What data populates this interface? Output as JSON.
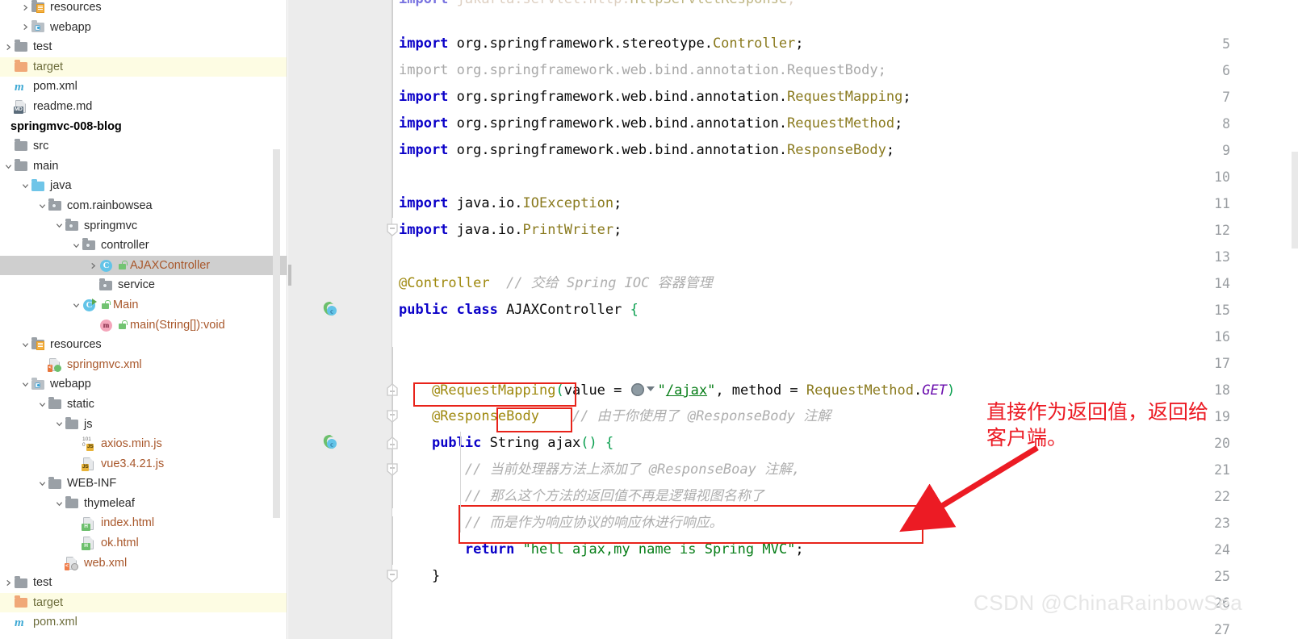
{
  "project_tree": {
    "items": [
      {
        "indent": 1,
        "arrow": "chevron-right",
        "icon": "folder-resources",
        "label": "resources",
        "style": "plain",
        "state": "collapsed"
      },
      {
        "indent": 1,
        "arrow": "chevron-right",
        "icon": "folder-webapp",
        "label": "webapp",
        "style": "plain",
        "state": "collapsed"
      },
      {
        "indent": 0,
        "arrow": "chevron-right",
        "icon": "folder-grey",
        "label": "test",
        "style": "plain",
        "state": "collapsed"
      },
      {
        "indent": 0,
        "arrow": "none",
        "icon": "folder-orange",
        "label": "target",
        "style": "olive",
        "state": "highlighted"
      },
      {
        "indent": 0,
        "arrow": "none",
        "icon": "maven-pom",
        "label": "pom.xml",
        "style": "plain",
        "state": "none"
      },
      {
        "indent": 0,
        "arrow": "none",
        "icon": "file-md",
        "label": "readme.md",
        "style": "plain",
        "state": "none"
      },
      {
        "indent": -1,
        "arrow": "none",
        "icon": "none",
        "label": "springmvc-008-blog",
        "style": "bold",
        "state": "none"
      },
      {
        "indent": 0,
        "arrow": "none",
        "icon": "folder-grey",
        "label": "src",
        "style": "plain",
        "state": "none"
      },
      {
        "indent": 0,
        "arrow": "chevron-down",
        "icon": "folder-grey",
        "label": "main",
        "style": "plain",
        "state": "expanded"
      },
      {
        "indent": 1,
        "arrow": "chevron-down",
        "icon": "folder-blue",
        "label": "java",
        "style": "plain",
        "state": "expanded"
      },
      {
        "indent": 2,
        "arrow": "chevron-down",
        "icon": "folder-package",
        "label": "com.rainbowsea",
        "style": "plain",
        "state": "expanded"
      },
      {
        "indent": 3,
        "arrow": "chevron-down",
        "icon": "folder-package",
        "label": "springmvc",
        "style": "plain",
        "state": "expanded"
      },
      {
        "indent": 4,
        "arrow": "chevron-down",
        "icon": "folder-package",
        "label": "controller",
        "style": "plain",
        "state": "expanded"
      },
      {
        "indent": 5,
        "arrow": "chevron-right",
        "icon": "java-class",
        "label": "AJAXController",
        "style": "orange",
        "state": "selected",
        "lock": true
      },
      {
        "indent": 5,
        "arrow": "none",
        "icon": "folder-package",
        "label": "service",
        "style": "plain",
        "state": "none"
      },
      {
        "indent": 4,
        "arrow": "chevron-down",
        "icon": "java-class-runnable",
        "label": "Main",
        "style": "orange",
        "state": "expanded",
        "lock": true
      },
      {
        "indent": 5,
        "arrow": "none",
        "icon": "java-method",
        "label": "main(String[]):void",
        "style": "orange",
        "state": "none",
        "lock": true
      },
      {
        "indent": 1,
        "arrow": "chevron-down",
        "icon": "folder-resources",
        "label": "resources",
        "style": "plain",
        "state": "expanded"
      },
      {
        "indent": 2,
        "arrow": "none",
        "icon": "file-spring-xml",
        "label": "springmvc.xml",
        "style": "orange",
        "state": "none"
      },
      {
        "indent": 1,
        "arrow": "chevron-down",
        "icon": "folder-webapp",
        "label": "webapp",
        "style": "plain",
        "state": "expanded"
      },
      {
        "indent": 2,
        "arrow": "chevron-down",
        "icon": "folder-grey",
        "label": "static",
        "style": "plain",
        "state": "expanded"
      },
      {
        "indent": 3,
        "arrow": "chevron-down",
        "icon": "folder-grey",
        "label": "js",
        "style": "plain",
        "state": "expanded"
      },
      {
        "indent": 4,
        "arrow": "none",
        "icon": "file-js-minified",
        "label": "axios.min.js",
        "style": "orange",
        "state": "none"
      },
      {
        "indent": 4,
        "arrow": "none",
        "icon": "file-js",
        "label": "vue3.4.21.js",
        "style": "orange",
        "state": "none"
      },
      {
        "indent": 2,
        "arrow": "chevron-down",
        "icon": "folder-grey",
        "label": "WEB-INF",
        "style": "plain",
        "state": "expanded"
      },
      {
        "indent": 3,
        "arrow": "chevron-down",
        "icon": "folder-grey",
        "label": "thymeleaf",
        "style": "plain",
        "state": "expanded"
      },
      {
        "indent": 4,
        "arrow": "none",
        "icon": "file-html",
        "label": "index.html",
        "style": "orange",
        "state": "none"
      },
      {
        "indent": 4,
        "arrow": "none",
        "icon": "file-html",
        "label": "ok.html",
        "style": "orange",
        "state": "none"
      },
      {
        "indent": 3,
        "arrow": "none",
        "icon": "file-web-xml",
        "label": "web.xml",
        "style": "orange",
        "state": "none"
      },
      {
        "indent": 0,
        "arrow": "chevron-right",
        "icon": "folder-grey",
        "label": "test",
        "style": "plain",
        "state": "collapsed"
      },
      {
        "indent": 0,
        "arrow": "none",
        "icon": "folder-orange",
        "label": "target",
        "style": "olive",
        "state": "highlighted"
      },
      {
        "indent": 0,
        "arrow": "none",
        "icon": "maven-pom",
        "label": "pom.xml",
        "style": "olive",
        "state": "none"
      }
    ]
  },
  "editor": {
    "lines": [
      {
        "num": "",
        "text": "import jakarta.servlet.http.HttpServletResponse;",
        "clipped": true
      },
      {
        "num": "5",
        "text": "import org.springframework.stereotype.Controller;"
      },
      {
        "num": "6",
        "text": "import org.springframework.web.bind.annotation.RequestBody;"
      },
      {
        "num": "7",
        "text": "import org.springframework.web.bind.annotation.RequestMapping;"
      },
      {
        "num": "8",
        "text": "import org.springframework.web.bind.annotation.RequestMethod;"
      },
      {
        "num": "9",
        "text": "import org.springframework.web.bind.annotation.ResponseBody;"
      },
      {
        "num": "10",
        "text": ""
      },
      {
        "num": "11",
        "text": "import java.io.IOException;"
      },
      {
        "num": "12",
        "text": "import java.io.PrintWriter;"
      },
      {
        "num": "13",
        "text": ""
      },
      {
        "num": "14",
        "text": "@Controller  // 交给 Spring IOC 容器管理"
      },
      {
        "num": "15",
        "text": "public class AJAXController {"
      },
      {
        "num": "16",
        "text": ""
      },
      {
        "num": "17",
        "text": ""
      },
      {
        "num": "18",
        "text": "    @RequestMapping(value = \"/ajax\", method = RequestMethod.GET)"
      },
      {
        "num": "19",
        "text": "    @ResponseBody    // 由于你使用了 @ResponseBody 注解"
      },
      {
        "num": "20",
        "text": "    public String ajax() {"
      },
      {
        "num": "21",
        "text": "        // 当前处理器方法上添加了 @ResponseBoay 注解,"
      },
      {
        "num": "22",
        "text": "        // 那么这个方法的返回值不再是逻辑视图名称了"
      },
      {
        "num": "23",
        "text": "        // 而是作为响应协议的响应休进行响应。"
      },
      {
        "num": "24",
        "text": "        return \"hell ajax,my name is Spring MVC\";"
      },
      {
        "num": "25",
        "text": "    }"
      },
      {
        "num": "26",
        "text": ""
      },
      {
        "num": "27",
        "text": ""
      }
    ],
    "gutter_icons": [
      {
        "line": "15",
        "icon": "spring-bean-icon"
      },
      {
        "line": "20",
        "icon": "spring-mapping-icon"
      }
    ],
    "url_hint_icon": "globe-dropdown-icon",
    "mapping_path": "/ajax"
  },
  "annotations": {
    "red_note": "直接作为返回值，返回给\n客户端。",
    "red_color": "#ec1b24",
    "boxes": [
      {
        "name": "responsebody-annotation-box"
      },
      {
        "name": "string-return-type-box"
      },
      {
        "name": "return-statement-box"
      }
    ]
  },
  "watermark": {
    "text": "CSDN @ChinaRainbowSea"
  }
}
